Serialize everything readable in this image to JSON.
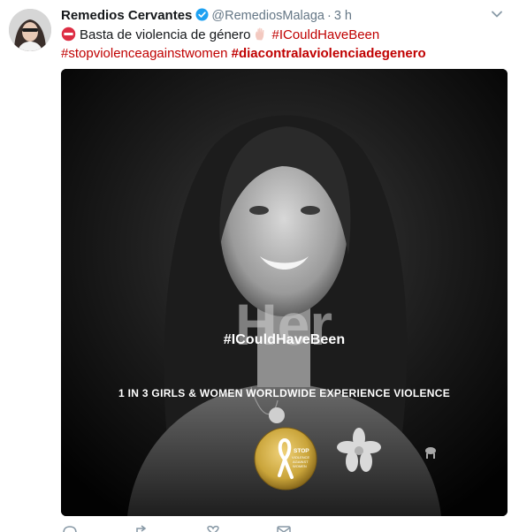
{
  "tweet": {
    "display_name": "Remedios Cervantes",
    "handle": "@RemediosMalaga",
    "separator": "·",
    "time": "3 h",
    "text_line1": "Basta de violencia de género",
    "hashtag1": "#ICouldHaveBeen",
    "hashtag2": "#stopviolenceagainstwomen",
    "hashtag3": "#diacontralaviolenciadegenero"
  },
  "media": {
    "overlay_hashtag": "#ICouldHaveBeen",
    "overlay_stat": "1 IN 3 GIRLS & WOMEN WORLDWIDE EXPERIENCE VIOLENCE",
    "shirt_word": "Her",
    "badge_text": "STOP VIOLENCE AGAINST WOMEN"
  },
  "colors": {
    "accent": "#c00000",
    "verified": "#1da1f2",
    "meta_text": "#657786",
    "badge_gold": "#c9a43a"
  },
  "icons": [
    "verified-icon",
    "no-entry-icon",
    "raised-hand-icon",
    "caret-down-icon",
    "reply-icon",
    "retweet-icon",
    "like-icon",
    "message-icon"
  ]
}
